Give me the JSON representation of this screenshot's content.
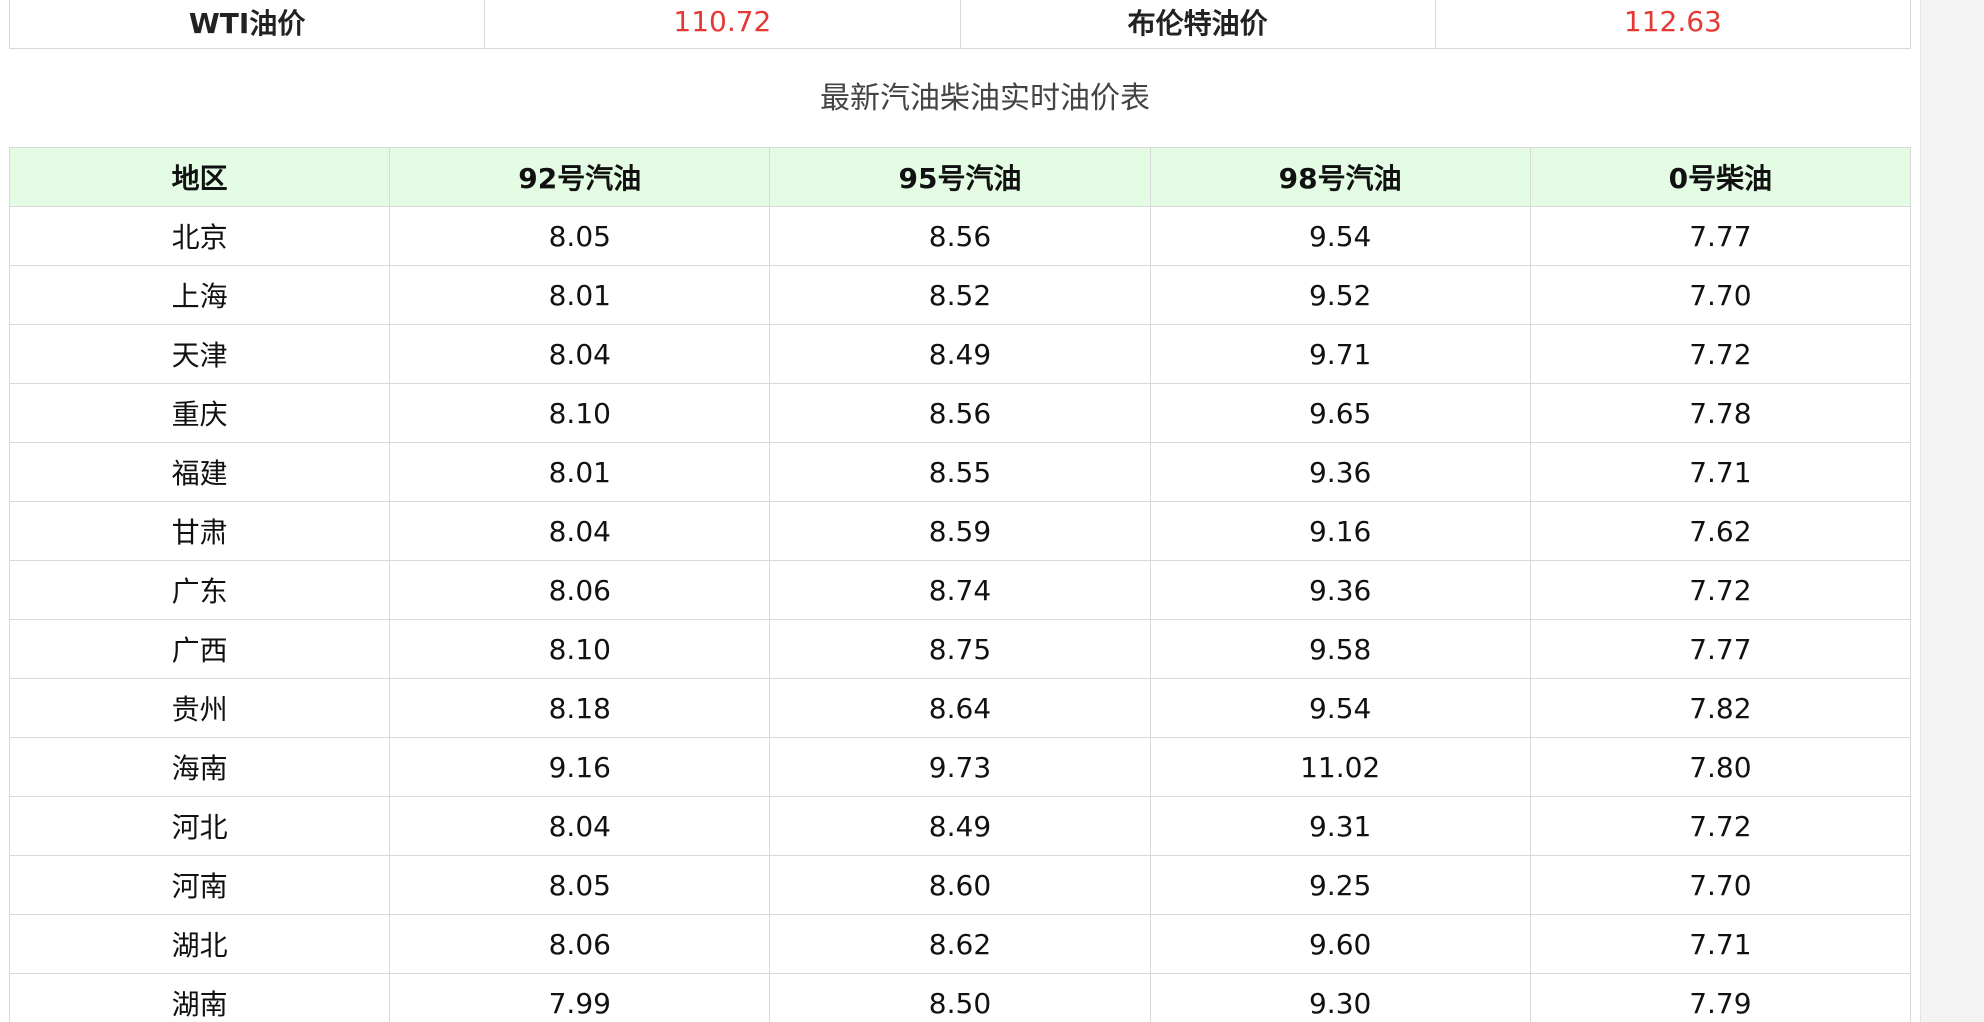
{
  "crude": {
    "wti_label": "WTI油价",
    "wti_value": "110.72",
    "brent_label": "布伦特油价",
    "brent_value": "112.63",
    "value_color": "#e53935"
  },
  "table_title": "最新汽油柴油实时油价表",
  "header_color": "#e4fbe4",
  "columns": [
    "地区",
    "92号汽油",
    "95号汽油",
    "98号汽油",
    "0号柴油"
  ],
  "rows": [
    [
      "北京",
      "8.05",
      "8.56",
      "9.54",
      "7.77"
    ],
    [
      "上海",
      "8.01",
      "8.52",
      "9.52",
      "7.70"
    ],
    [
      "天津",
      "8.04",
      "8.49",
      "9.71",
      "7.72"
    ],
    [
      "重庆",
      "8.10",
      "8.56",
      "9.65",
      "7.78"
    ],
    [
      "福建",
      "8.01",
      "8.55",
      "9.36",
      "7.71"
    ],
    [
      "甘肃",
      "8.04",
      "8.59",
      "9.16",
      "7.62"
    ],
    [
      "广东",
      "8.06",
      "8.74",
      "9.36",
      "7.72"
    ],
    [
      "广西",
      "8.10",
      "8.75",
      "9.58",
      "7.77"
    ],
    [
      "贵州",
      "8.18",
      "8.64",
      "9.54",
      "7.82"
    ],
    [
      "海南",
      "9.16",
      "9.73",
      "11.02",
      "7.80"
    ],
    [
      "河北",
      "8.04",
      "8.49",
      "9.31",
      "7.72"
    ],
    [
      "河南",
      "8.05",
      "8.60",
      "9.25",
      "7.70"
    ],
    [
      "湖北",
      "8.06",
      "8.62",
      "9.60",
      "7.71"
    ],
    [
      "湖南",
      "7.99",
      "8.50",
      "9.30",
      "7.79"
    ]
  ]
}
